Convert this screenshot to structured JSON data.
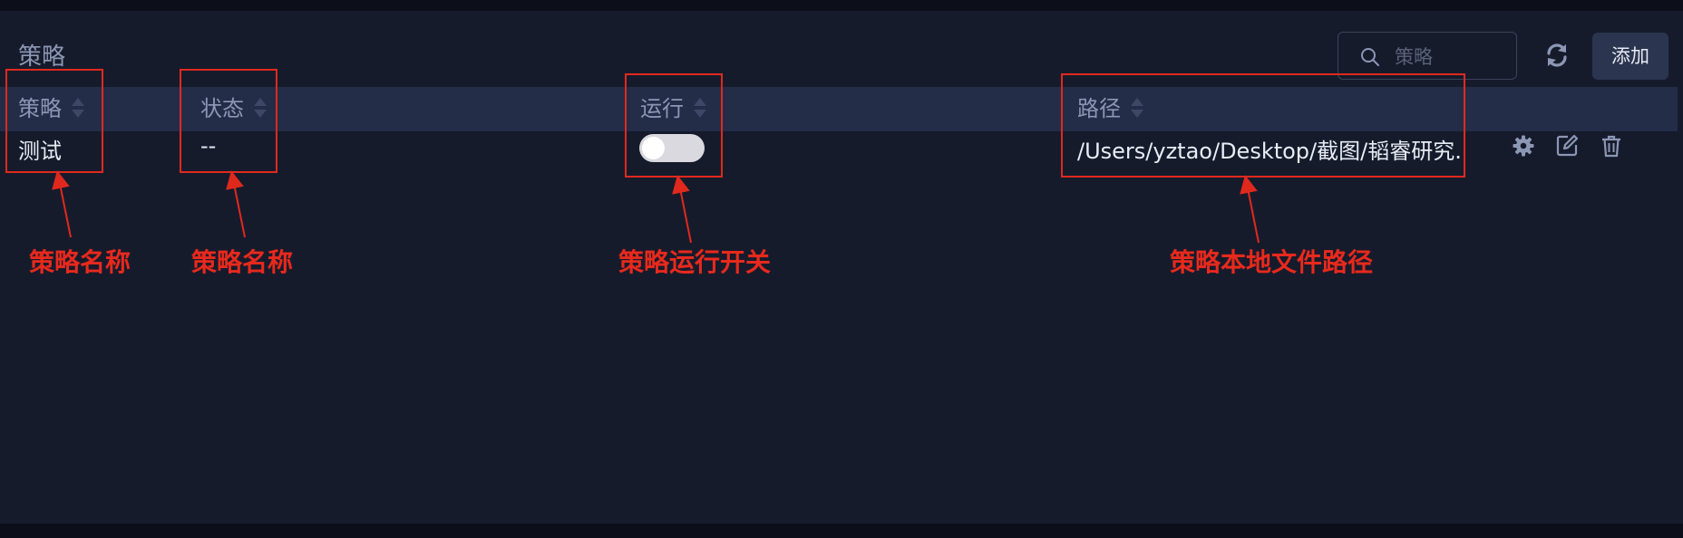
{
  "header": {
    "title": "策略",
    "search_placeholder": "策略",
    "add_label": "添加"
  },
  "table": {
    "columns": [
      "策略",
      "状态",
      "运行",
      "路径"
    ],
    "rows": [
      {
        "strategy": "测试",
        "status": "--",
        "running": false,
        "path": "/Users/yztao/Desktop/截图/韬睿研究..."
      }
    ]
  },
  "annotations": [
    "策略名称",
    "策略名称",
    "策略运行开关",
    "策略本地文件路径"
  ],
  "colors": {
    "panel_bg": "#161b2c",
    "header_row_bg": "#232d48",
    "annotation_red": "#e8291c"
  },
  "icons": [
    "search-icon",
    "refresh-icon",
    "sort-icon",
    "gear-icon",
    "edit-icon",
    "trash-icon"
  ]
}
